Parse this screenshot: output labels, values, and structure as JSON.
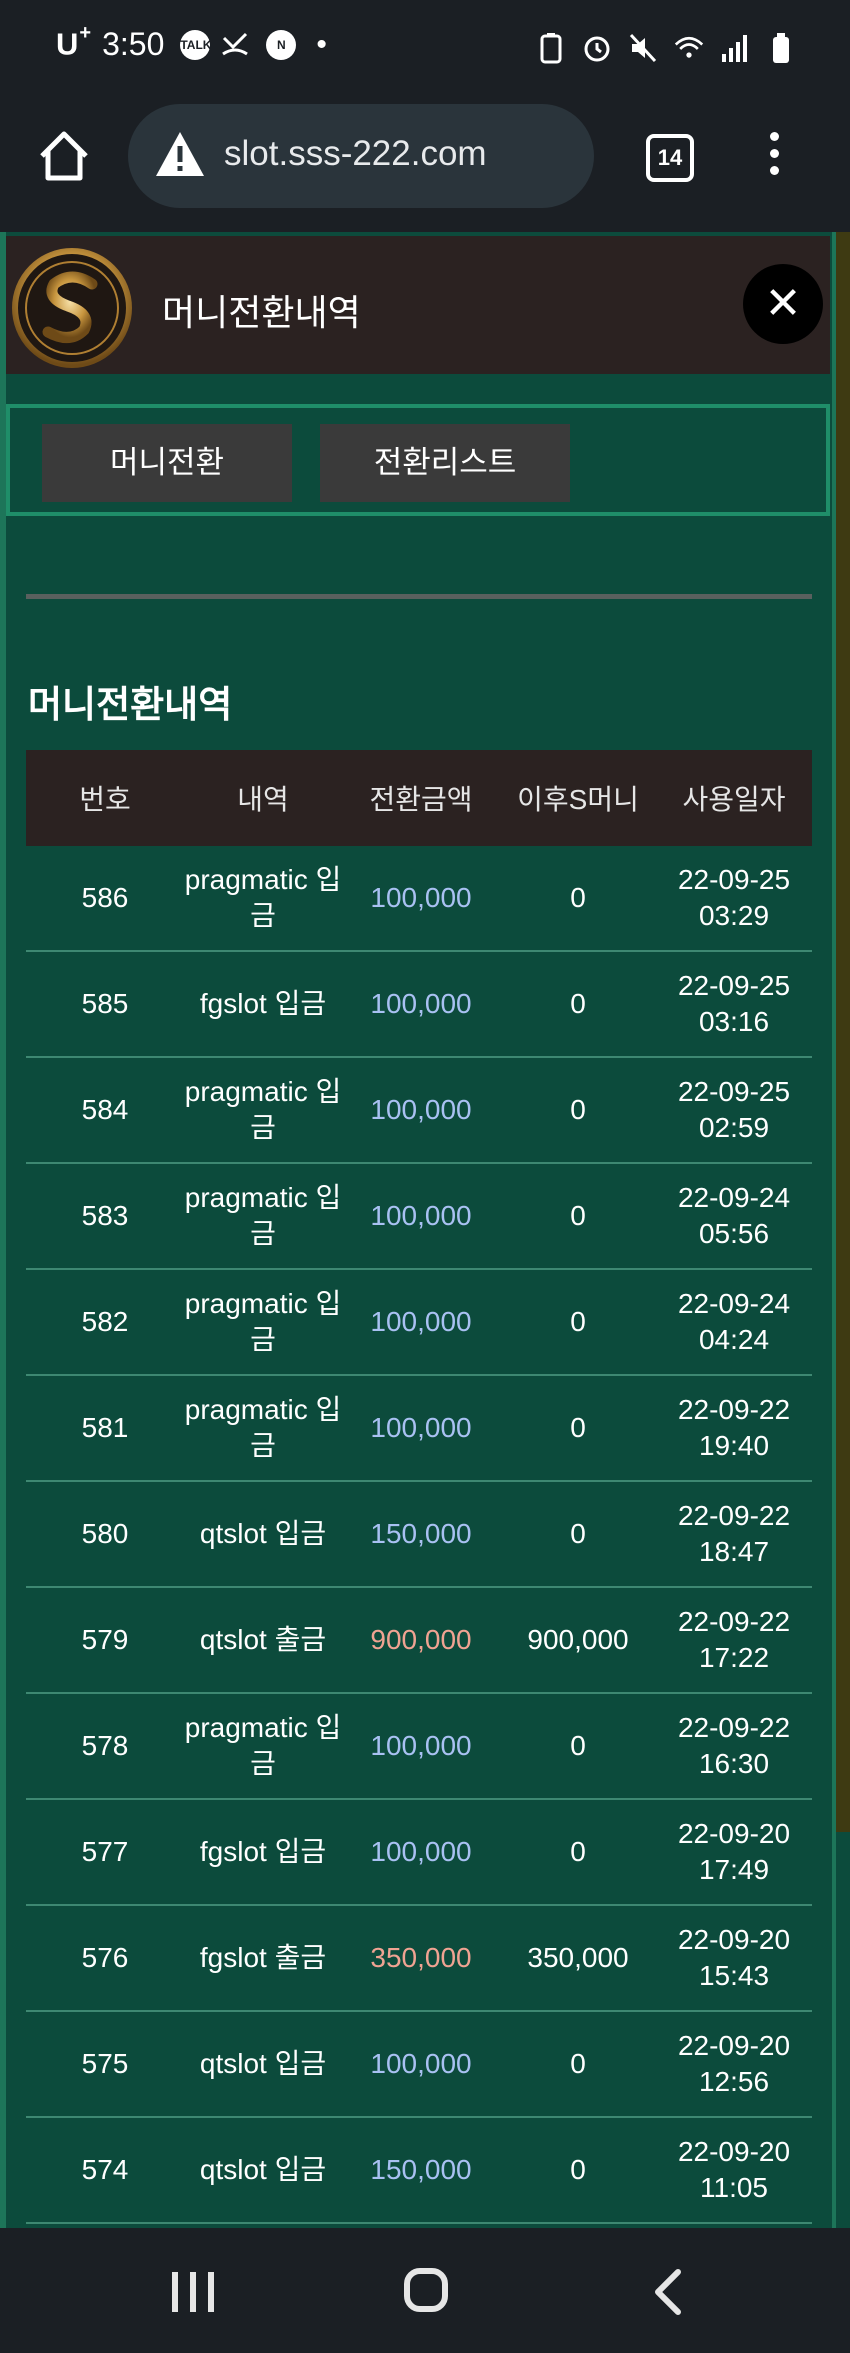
{
  "status_bar": {
    "carrier": "U",
    "carrier_sup": "+",
    "time": "3:50",
    "noti_talk": "TALK",
    "noti_n": "N",
    "dot": "•"
  },
  "browser": {
    "url": "slot.sss-222.com",
    "tab_count": "14"
  },
  "modal": {
    "title": "머니전환내역",
    "close": "✕"
  },
  "tabs": [
    {
      "label": "머니전환"
    },
    {
      "label": "전환리스트"
    }
  ],
  "section_title": "머니전환내역",
  "table": {
    "headers": [
      "번호",
      "내역",
      "전환금액",
      "이후S머니",
      "사용일자"
    ],
    "rows": [
      {
        "no": "586",
        "desc": "pragmatic 입금",
        "amount": "100,000",
        "type": "in",
        "after": "0",
        "date": "22-09-25",
        "time": "03:29"
      },
      {
        "no": "585",
        "desc": "fgslot 입금",
        "amount": "100,000",
        "type": "in",
        "after": "0",
        "date": "22-09-25",
        "time": "03:16"
      },
      {
        "no": "584",
        "desc": "pragmatic 입금",
        "amount": "100,000",
        "type": "in",
        "after": "0",
        "date": "22-09-25",
        "time": "02:59"
      },
      {
        "no": "583",
        "desc": "pragmatic 입금",
        "amount": "100,000",
        "type": "in",
        "after": "0",
        "date": "22-09-24",
        "time": "05:56"
      },
      {
        "no": "582",
        "desc": "pragmatic 입금",
        "amount": "100,000",
        "type": "in",
        "after": "0",
        "date": "22-09-24",
        "time": "04:24"
      },
      {
        "no": "581",
        "desc": "pragmatic 입금",
        "amount": "100,000",
        "type": "in",
        "after": "0",
        "date": "22-09-22",
        "time": "19:40"
      },
      {
        "no": "580",
        "desc": "qtslot 입금",
        "amount": "150,000",
        "type": "in",
        "after": "0",
        "date": "22-09-22",
        "time": "18:47"
      },
      {
        "no": "579",
        "desc": "qtslot 출금",
        "amount": "900,000",
        "type": "out",
        "after": "900,000",
        "date": "22-09-22",
        "time": "17:22"
      },
      {
        "no": "578",
        "desc": "pragmatic 입금",
        "amount": "100,000",
        "type": "in",
        "after": "0",
        "date": "22-09-22",
        "time": "16:30"
      },
      {
        "no": "577",
        "desc": "fgslot 입금",
        "amount": "100,000",
        "type": "in",
        "after": "0",
        "date": "22-09-20",
        "time": "17:49"
      },
      {
        "no": "576",
        "desc": "fgslot 출금",
        "amount": "350,000",
        "type": "out",
        "after": "350,000",
        "date": "22-09-20",
        "time": "15:43"
      },
      {
        "no": "575",
        "desc": "qtslot 입금",
        "amount": "100,000",
        "type": "in",
        "after": "0",
        "date": "22-09-20",
        "time": "12:56"
      },
      {
        "no": "574",
        "desc": "qtslot 입금",
        "amount": "150,000",
        "type": "in",
        "after": "0",
        "date": "22-09-20",
        "time": "11:05"
      }
    ]
  },
  "colors": {
    "page_bg": "#0c4b3c",
    "header_bg": "#2b2221",
    "deposit_amount": "#a9c1f2",
    "withdraw_amount": "#f0a392",
    "accent_border": "#1f8e69"
  }
}
